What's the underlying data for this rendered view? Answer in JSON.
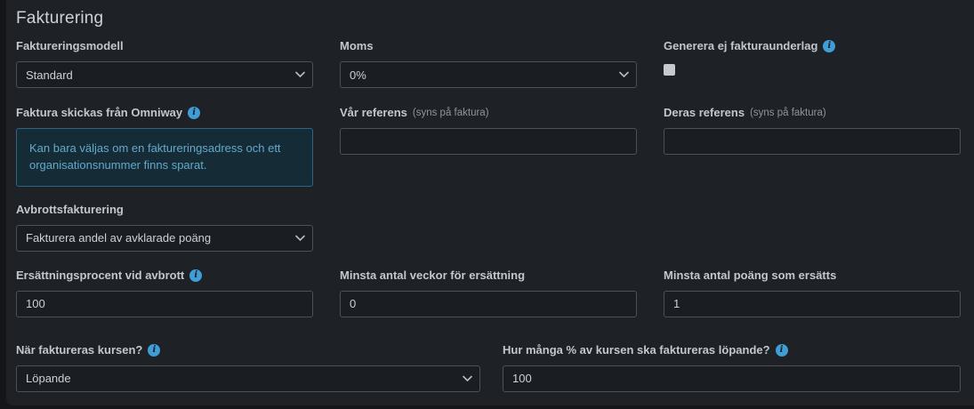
{
  "page": {
    "title": "Fakturering"
  },
  "colors": {
    "panel_bg": "#1e2226",
    "accent_blue": "#3f9ed6",
    "info_box_bg": "#152b36",
    "info_box_border": "#2d6587",
    "info_box_text": "#64a9cc"
  },
  "fields": {
    "faktureringsmodell": {
      "label": "Faktureringsmodell",
      "value": "Standard"
    },
    "moms": {
      "label": "Moms",
      "value": "0%"
    },
    "generera_ej_fakturaunderlag": {
      "label": "Generera ej fakturaunderlag",
      "checked": false
    },
    "faktura_skickas_fran_omniway": {
      "label": "Faktura skickas från Omniway",
      "info_text": "Kan bara väljas om en faktureringsadress och ett organisationsnummer finns sparat."
    },
    "var_referens": {
      "label": "Vår referens",
      "suffix": "(syns på faktura)",
      "value": ""
    },
    "deras_referens": {
      "label": "Deras referens",
      "suffix": "(syns på faktura)",
      "value": ""
    },
    "avbrottsfakturering": {
      "label": "Avbrottsfakturering",
      "value": "Fakturera andel av avklarade poäng"
    },
    "ersattningsprocent_vid_avbrott": {
      "label": "Ersättningsprocent vid avbrott",
      "value": "100"
    },
    "minsta_antal_veckor": {
      "label": "Minsta antal veckor för ersättning",
      "value": "0"
    },
    "minsta_antal_poang": {
      "label": "Minsta antal poäng som ersätts",
      "value": "1"
    },
    "nar_faktureras_kursen": {
      "label": "När faktureras kursen?",
      "value": "Löpande"
    },
    "procent_lopande": {
      "label": "Hur många % av kursen ska faktureras löpande?",
      "value": "100"
    }
  }
}
